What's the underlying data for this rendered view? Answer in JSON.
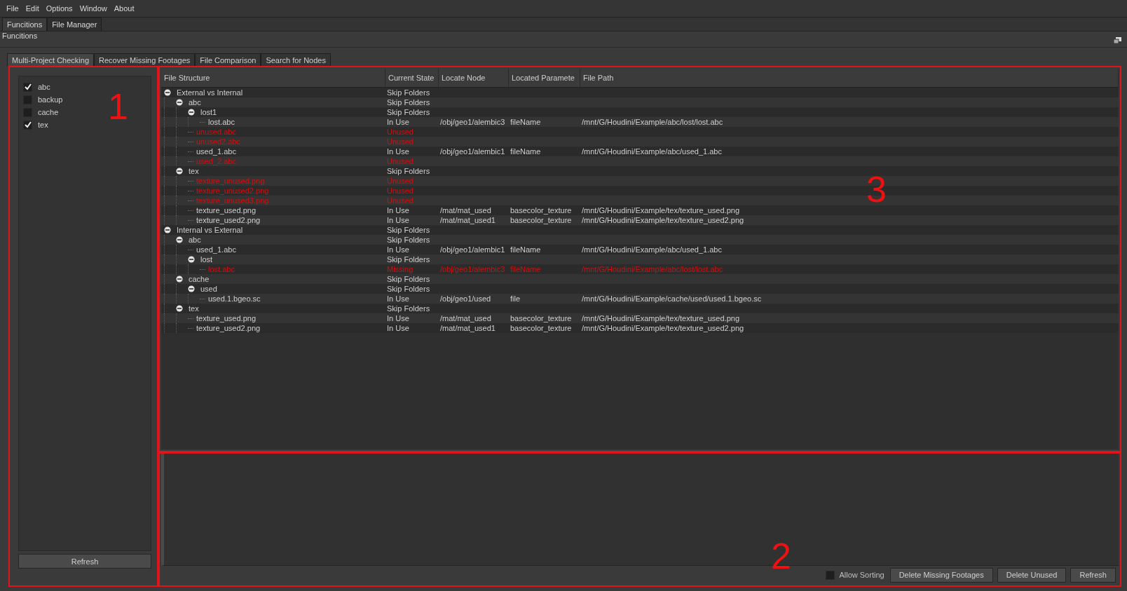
{
  "menu": [
    "File",
    "Edit",
    "Options",
    "Window",
    "About"
  ],
  "top_tabs": [
    {
      "label": "Funcitions",
      "selected": true
    },
    {
      "label": "File Manager",
      "selected": false
    }
  ],
  "pane_title": "Funcitions",
  "tabs": [
    {
      "label": "Multi-Project Checking",
      "selected": true
    },
    {
      "label": "Recover Missing Footages",
      "selected": false
    },
    {
      "label": "File Comparison",
      "selected": false
    },
    {
      "label": "Search for Nodes",
      "selected": false
    }
  ],
  "folders": [
    {
      "label": "abc",
      "checked": true
    },
    {
      "label": "backup",
      "checked": false
    },
    {
      "label": "cache",
      "checked": false
    },
    {
      "label": "tex",
      "checked": true
    }
  ],
  "left_refresh": "Refresh",
  "table": {
    "columns": [
      "File Structure",
      "Current State",
      "Locate Node",
      "Located Paramete",
      "File Path"
    ],
    "rows": [
      {
        "name": "External vs Internal",
        "state": "Skip Folders",
        "expanded": true,
        "flagged": false,
        "children": [
          {
            "name": "abc",
            "state": "Skip Folders",
            "expanded": true,
            "flagged": false,
            "children": [
              {
                "name": "lost1",
                "state": "Skip Folders",
                "expanded": true,
                "flagged": false,
                "children": [
                  {
                    "name": "lost.abc",
                    "state": "In Use",
                    "node": "/obj/geo1/alembic3",
                    "param": "fileName",
                    "path": "/mnt/G/Houdini/Example/abc/lost/lost.abc",
                    "flagged": false
                  }
                ]
              },
              {
                "name": "unused.abc",
                "state": "Unused",
                "flagged": true
              },
              {
                "name": "unused2.abc",
                "state": "Unused",
                "flagged": true
              },
              {
                "name": "used_1.abc",
                "state": "In Use",
                "node": "/obj/geo1/alembic1",
                "param": "fileName",
                "path": "/mnt/G/Houdini/Example/abc/used_1.abc",
                "flagged": false
              },
              {
                "name": "used_2.abc",
                "state": "Unused",
                "flagged": true
              }
            ]
          },
          {
            "name": "tex",
            "state": "Skip Folders",
            "expanded": true,
            "flagged": false,
            "children": [
              {
                "name": "texture_unused.png",
                "state": "Unused",
                "flagged": true
              },
              {
                "name": "texture_unused2.png",
                "state": "Unused",
                "flagged": true
              },
              {
                "name": "texture_unused3.png",
                "state": "Unused",
                "flagged": true
              },
              {
                "name": "texture_used.png",
                "state": "In Use",
                "node": "/mat/mat_used",
                "param": "basecolor_texture",
                "path": "/mnt/G/Houdini/Example/tex/texture_used.png",
                "flagged": false
              },
              {
                "name": "texture_used2.png",
                "state": "In Use",
                "node": "/mat/mat_used1",
                "param": "basecolor_texture",
                "path": "/mnt/G/Houdini/Example/tex/texture_used2.png",
                "flagged": false
              }
            ]
          }
        ]
      },
      {
        "name": "Internal vs External",
        "state": "Skip Folders",
        "expanded": true,
        "flagged": false,
        "children": [
          {
            "name": "abc",
            "state": "Skip Folders",
            "expanded": true,
            "flagged": false,
            "children": [
              {
                "name": "used_1.abc",
                "state": "In Use",
                "node": "/obj/geo1/alembic1",
                "param": "fileName",
                "path": "/mnt/G/Houdini/Example/abc/used_1.abc",
                "flagged": false
              },
              {
                "name": "lost",
                "state": "Skip Folders",
                "expanded": true,
                "flagged": false,
                "children": [
                  {
                    "name": "lost.abc",
                    "state": "Missing",
                    "node": "/obj/geo1/alembic3",
                    "param": "fileName",
                    "path": "/mnt/G/Houdini/Example/abc/lost/lost.abc",
                    "flagged": true
                  }
                ]
              }
            ]
          },
          {
            "name": "cache",
            "state": "Skip Folders",
            "expanded": true,
            "flagged": false,
            "children": [
              {
                "name": "used",
                "state": "Skip Folders",
                "expanded": true,
                "flagged": false,
                "children": [
                  {
                    "name": "used.1.bgeo.sc",
                    "state": "In Use",
                    "node": "/obj/geo1/used",
                    "param": "file",
                    "path": "/mnt/G/Houdini/Example/cache/used/used.1.bgeo.sc",
                    "flagged": false
                  }
                ]
              }
            ]
          },
          {
            "name": "tex",
            "state": "Skip Folders",
            "expanded": true,
            "flagged": false,
            "children": [
              {
                "name": "texture_used.png",
                "state": "In Use",
                "node": "/mat/mat_used",
                "param": "basecolor_texture",
                "path": "/mnt/G/Houdini/Example/tex/texture_used.png",
                "flagged": false
              },
              {
                "name": "texture_used2.png",
                "state": "In Use",
                "node": "/mat/mat_used1",
                "param": "basecolor_texture",
                "path": "/mnt/G/Houdini/Example/tex/texture_used2.png",
                "flagged": false
              }
            ]
          }
        ]
      }
    ]
  },
  "allow_sorting": {
    "label": "Allow Sorting",
    "checked": false
  },
  "buttons": [
    "Delete Missing Footages",
    "Delete Unused",
    "Refresh"
  ],
  "callouts": {
    "folders": "1",
    "actions": "2",
    "table": "3"
  }
}
